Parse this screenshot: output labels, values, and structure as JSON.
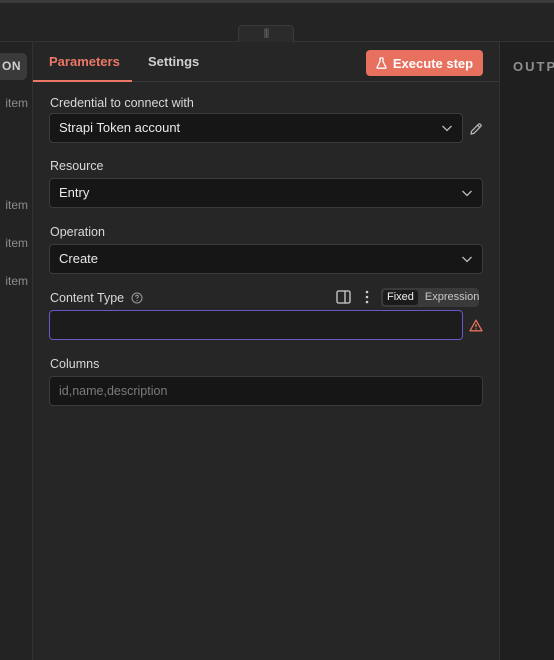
{
  "left_panel": {
    "chip_label": "ON",
    "item_labels": [
      "item",
      "item",
      "item",
      "item"
    ]
  },
  "tabs": {
    "parameters": "Parameters",
    "settings": "Settings"
  },
  "execute_button": "Execute step",
  "credential": {
    "label": "Credential to connect with",
    "value": "Strapi Token account"
  },
  "resource": {
    "label": "Resource",
    "value": "Entry"
  },
  "operation": {
    "label": "Operation",
    "value": "Create"
  },
  "content_type": {
    "label": "Content Type",
    "value": "",
    "toggle": {
      "fixed": "Fixed",
      "expression": "Expression",
      "selected": "Fixed"
    }
  },
  "columns": {
    "label": "Columns",
    "placeholder": "id,name,description"
  },
  "output_panel": {
    "title": "OUTPUT"
  },
  "colors": {
    "accent": "#e8705f",
    "focus_border": "#6a58c9",
    "warning": "#e8705f"
  },
  "icons": [
    "grip-icon",
    "flask-icon",
    "pencil-icon",
    "chevron-down-icon",
    "help-circle-icon",
    "panel-icon",
    "kebab-icon",
    "warning-icon"
  ]
}
